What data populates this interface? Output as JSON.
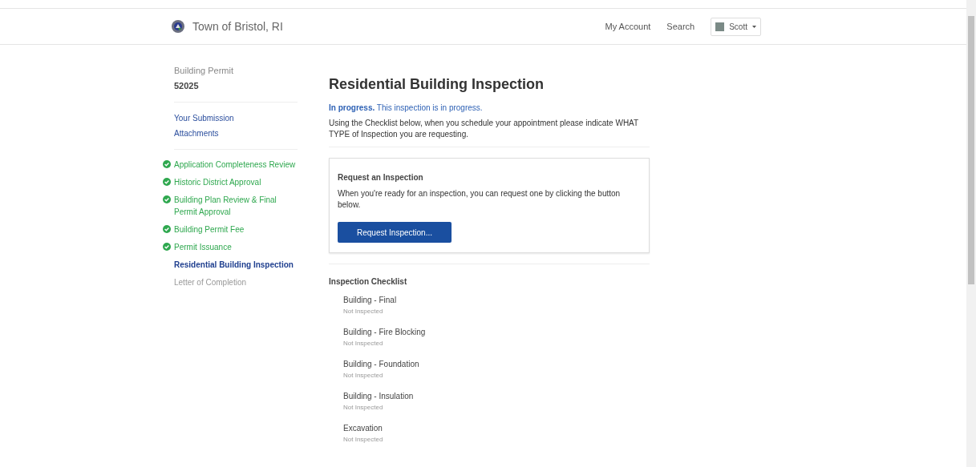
{
  "header": {
    "site_title": "Town of Bristol, RI",
    "nav": [
      "My Account",
      "Search"
    ],
    "user": {
      "name": "Scott"
    }
  },
  "sidebar": {
    "record_type": "Building Permit",
    "record_number": "52025",
    "links": [
      "Your Submission",
      "Attachments"
    ],
    "steps": [
      {
        "label": "Application Completeness Review",
        "kind": "done"
      },
      {
        "label": "Historic District Approval",
        "kind": "done"
      },
      {
        "label": "Building Plan Review & Final Permit Approval",
        "kind": "done"
      },
      {
        "label": "Building Permit Fee",
        "kind": "done"
      },
      {
        "label": "Permit Issuance",
        "kind": "done"
      },
      {
        "label": "Residential Building Inspection",
        "kind": "current"
      },
      {
        "label": "Letter of Completion",
        "kind": "pending"
      }
    ]
  },
  "main": {
    "title": "Residential Building Inspection",
    "status_line": "**In progress.** This inspection is in progress.",
    "instructions": "Using the Checklist below, when you schedule your appointment please indicate WHAT TYPE of Inspection you are requesting.",
    "request_card": {
      "title": "Request an Inspection",
      "text": "When you're ready for an inspection, you can request one by clicking the button below.",
      "button": "Request Inspection..."
    },
    "checklist": {
      "title": "Inspection Checklist",
      "items": [
        {
          "name": "Building - Final",
          "status": "Not Inspected"
        },
        {
          "name": "Building - Fire Blocking",
          "status": "Not Inspected"
        },
        {
          "name": "Building - Foundation",
          "status": "Not Inspected"
        },
        {
          "name": "Building - Insulation",
          "status": "Not Inspected"
        },
        {
          "name": "Excavation",
          "status": "Not Inspected"
        }
      ]
    }
  }
}
